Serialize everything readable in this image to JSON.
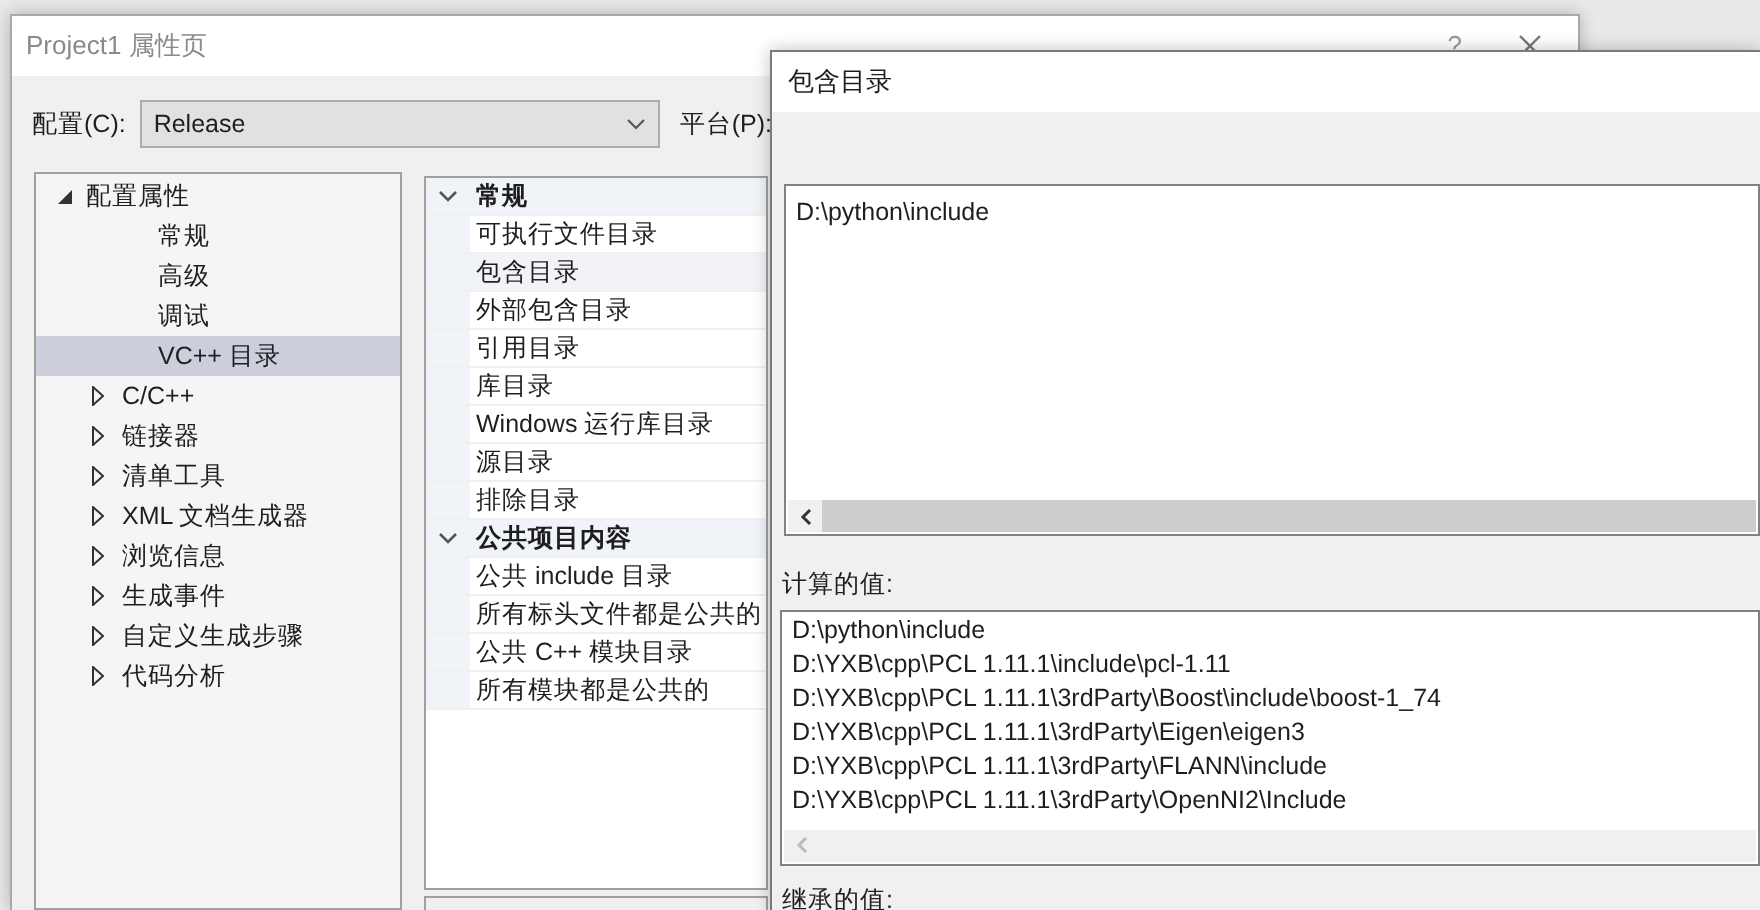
{
  "main_window": {
    "title": "Project1 属性页",
    "help_button": "?"
  },
  "config": {
    "label": "配置(C):",
    "value": "Release"
  },
  "platform": {
    "label": "平台(P):"
  },
  "tree": {
    "items": [
      {
        "label": "配置属性",
        "expanded": true,
        "selected": false,
        "children": [
          {
            "label": "常规",
            "selected": false
          },
          {
            "label": "高级",
            "selected": false
          },
          {
            "label": "调试",
            "selected": false
          },
          {
            "label": "VC++ 目录",
            "selected": true
          }
        ]
      },
      {
        "label": "C/C++",
        "expanded": false,
        "selected": false
      },
      {
        "label": "链接器",
        "expanded": false,
        "selected": false
      },
      {
        "label": "清单工具",
        "expanded": false,
        "selected": false
      },
      {
        "label": "XML 文档生成器",
        "expanded": false,
        "selected": false
      },
      {
        "label": "浏览信息",
        "expanded": false,
        "selected": false
      },
      {
        "label": "生成事件",
        "expanded": false,
        "selected": false
      },
      {
        "label": "自定义生成步骤",
        "expanded": false,
        "selected": false
      },
      {
        "label": "代码分析",
        "expanded": false,
        "selected": false
      }
    ]
  },
  "properties": {
    "groups": [
      {
        "label": "常规",
        "expanded": true,
        "rows": [
          {
            "label": "可执行文件目录",
            "selected": false
          },
          {
            "label": "包含目录",
            "selected": true
          },
          {
            "label": "外部包含目录",
            "selected": false
          },
          {
            "label": "引用目录",
            "selected": false
          },
          {
            "label": "库目录",
            "selected": false
          },
          {
            "label": "Windows 运行库目录",
            "selected": false
          },
          {
            "label": "源目录",
            "selected": false
          },
          {
            "label": "排除目录",
            "selected": false
          }
        ]
      },
      {
        "label": "公共项目内容",
        "expanded": true,
        "rows": [
          {
            "label": "公共 include 目录",
            "selected": false
          },
          {
            "label": "所有标头文件都是公共的",
            "selected": false
          },
          {
            "label": "公共 C++ 模块目录",
            "selected": false
          },
          {
            "label": "所有模块都是公共的",
            "selected": false
          }
        ]
      }
    ]
  },
  "include_dialog": {
    "title": "包含目录",
    "edit_lines": [
      "D:\\python\\include"
    ],
    "computed_label": "计算的值:",
    "computed_lines": [
      "D:\\python\\include",
      "D:\\YXB\\cpp\\PCL 1.11.1\\include\\pcl-1.11",
      "D:\\YXB\\cpp\\PCL 1.11.1\\3rdParty\\Boost\\include\\boost-1_74",
      "D:\\YXB\\cpp\\PCL 1.11.1\\3rdParty\\Eigen\\eigen3",
      "D:\\YXB\\cpp\\PCL 1.11.1\\3rdParty\\FLANN\\include",
      "D:\\YXB\\cpp\\PCL 1.11.1\\3rdParty\\OpenNI2\\Include"
    ],
    "inherited_label": "继承的值:"
  }
}
